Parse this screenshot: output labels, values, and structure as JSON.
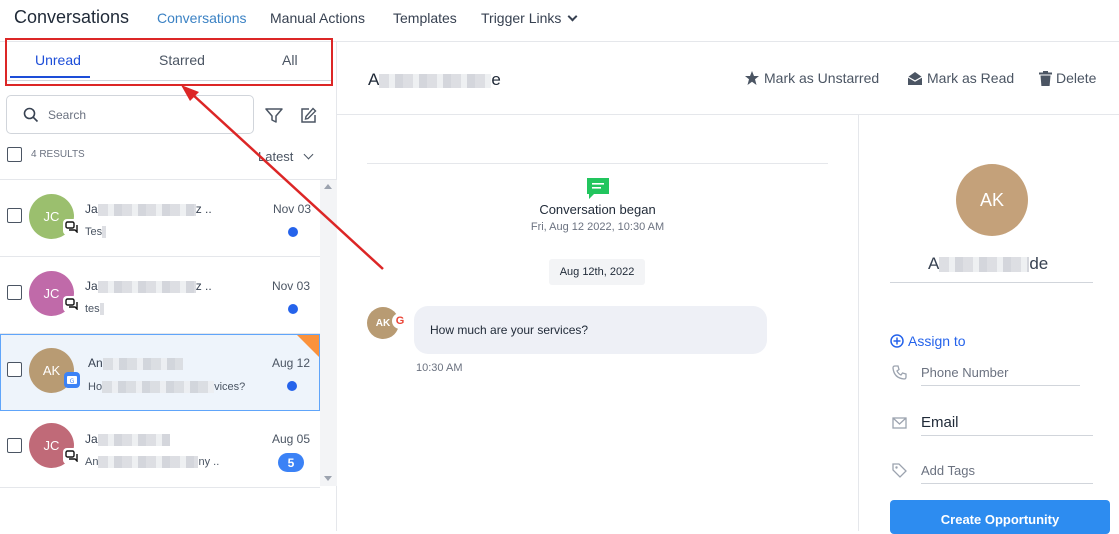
{
  "topbar": {
    "title": "Conversations",
    "nav": [
      "Conversations",
      "Manual Actions",
      "Templates",
      "Trigger Links"
    ]
  },
  "tabs": [
    "Unread",
    "Starred",
    "All"
  ],
  "search": {
    "placeholder": "Search"
  },
  "list_meta": {
    "results": "4 RESULTS",
    "sort": "Latest"
  },
  "conversations": [
    {
      "initials": "JC",
      "name_prefix": "Ja",
      "name_suffix": "z ..",
      "msg_prefix": "Tes",
      "msg_suffix": "",
      "date": "Nov 03",
      "color": "#9bbf6e",
      "unread": "dot"
    },
    {
      "initials": "JC",
      "name_prefix": "Ja",
      "name_suffix": "z ..",
      "msg_prefix": "tes",
      "msg_suffix": "",
      "date": "Nov 03",
      "color": "#c06aa9",
      "unread": "dot"
    },
    {
      "initials": "AK",
      "name_prefix": "An",
      "name_suffix": "",
      "msg_prefix": "Ho",
      "msg_suffix": "vices?",
      "date": "Aug 12",
      "color": "#b89b73",
      "unread": "dot"
    },
    {
      "initials": "JC",
      "name_prefix": "Ja",
      "name_suffix": "",
      "msg_prefix": "An",
      "msg_suffix": "ny ..",
      "date": "Aug 05",
      "color": "#c06a78",
      "unread": "5"
    }
  ],
  "chat": {
    "header_name_prefix": "A",
    "header_name_suffix": "e",
    "actions": [
      "Mark as Unstarred",
      "Mark as Read",
      "Delete"
    ],
    "began": "Conversation began",
    "began_date": "Fri, Aug 12 2022, 10:30 AM",
    "date_chip": "Aug 12th, 2022",
    "message": {
      "avatar": "AK",
      "text": "How much are your services?",
      "time": "10:30 AM"
    }
  },
  "contact": {
    "initials": "AK",
    "name_prefix": "A",
    "name_suffix": "de",
    "assign": "Assign to",
    "phone_placeholder": "Phone Number",
    "email": "Email",
    "tags_placeholder": "Add Tags",
    "create_button": "Create Opportunity"
  },
  "colors": {
    "accent": "#2563eb",
    "highlight": "#dc2626",
    "button": "#2d8cf0"
  }
}
